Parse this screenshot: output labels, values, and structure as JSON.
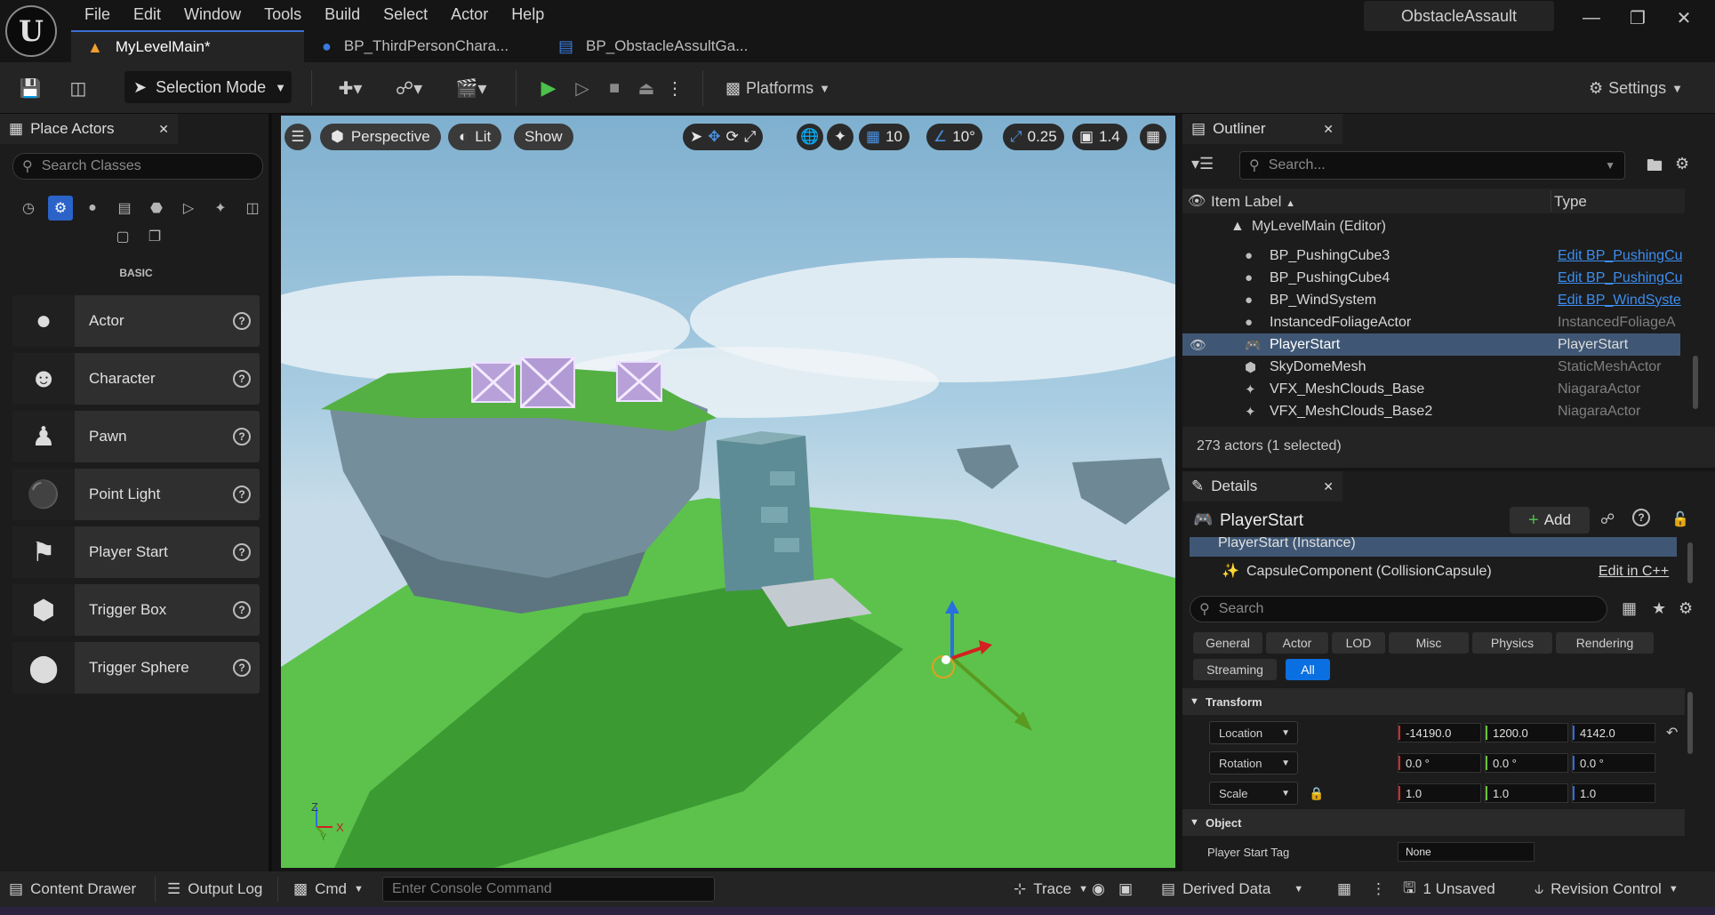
{
  "app": {
    "project": "ObstacleAssault"
  },
  "menu": [
    "File",
    "Edit",
    "Window",
    "Tools",
    "Build",
    "Select",
    "Actor",
    "Help"
  ],
  "tabs": [
    {
      "label": "MyLevelMain*"
    },
    {
      "label": "BP_ThirdPersonChara..."
    },
    {
      "label": "BP_ObstacleAssultGa..."
    }
  ],
  "toolbar": {
    "selection_mode": "Selection Mode",
    "platforms": "Platforms",
    "settings": "Settings"
  },
  "place_actors": {
    "title": "Place Actors",
    "search_placeholder": "Search Classes",
    "category": "BASIC",
    "items": [
      "Actor",
      "Character",
      "Pawn",
      "Point Light",
      "Player Start",
      "Trigger Box",
      "Trigger Sphere"
    ]
  },
  "viewport": {
    "view_mode": "Perspective",
    "lighting": "Lit",
    "show": "Show",
    "grid_snap": "10",
    "rotation_snap": "10°",
    "scale_snap": "0.25",
    "camera_speed": "1.4",
    "axis_labels": {
      "z": "Z",
      "x": "X",
      "y": "Y"
    }
  },
  "outliner": {
    "title": "Outliner",
    "search_placeholder": "Search...",
    "col_label": "Item Label",
    "col_type": "Type",
    "root": "MyLevelMain (Editor)",
    "rows": [
      {
        "name": "BP_PushingCube3",
        "type": "Edit BP_PushingCu",
        "link": true,
        "icon": "sphere-icon"
      },
      {
        "name": "BP_PushingCube4",
        "type": "Edit BP_PushingCu",
        "link": true,
        "icon": "sphere-icon"
      },
      {
        "name": "BP_WindSystem",
        "type": "Edit BP_WindSyste",
        "link": true,
        "icon": "sphere-icon"
      },
      {
        "name": "InstancedFoliageActor",
        "type": "InstancedFoliageA",
        "link": false,
        "icon": "sphere-icon"
      },
      {
        "name": "PlayerStart",
        "type": "PlayerStart",
        "link": false,
        "icon": "gamepad-icon",
        "selected": true
      },
      {
        "name": "SkyDomeMesh",
        "type": "StaticMeshActor",
        "link": false,
        "icon": "cube-icon"
      },
      {
        "name": "VFX_MeshClouds_Base",
        "type": "NiagaraActor",
        "link": false,
        "icon": "sparkle-icon"
      },
      {
        "name": "VFX_MeshClouds_Base2",
        "type": "NiagaraActor",
        "link": false,
        "icon": "sparkle-icon"
      }
    ],
    "status": "273 actors (1 selected)"
  },
  "details": {
    "title": "Details",
    "actor_name": "PlayerStart",
    "add_label": "Add",
    "instance_label": "PlayerStart (Instance)",
    "component_label": "CapsuleComponent (CollisionCapsule)",
    "edit_cpp": "Edit in C++",
    "search_placeholder": "Search",
    "filters": [
      "General",
      "Actor",
      "LOD",
      "Misc",
      "Physics",
      "Rendering",
      "Streaming",
      "All"
    ],
    "transform_header": "Transform",
    "location_label": "Location",
    "rotation_label": "Rotation",
    "scale_label": "Scale",
    "location": [
      "-14190.0",
      "1200.0",
      "4142.0"
    ],
    "rotation": [
      "0.0 °",
      "0.0 °",
      "0.0 °"
    ],
    "scale": [
      "1.0",
      "1.0",
      "1.0"
    ],
    "object_header": "Object",
    "player_start_tag_label": "Player Start Tag",
    "player_start_tag_value": "None"
  },
  "statusbar": {
    "content_drawer": "Content Drawer",
    "output_log": "Output Log",
    "cmd": "Cmd",
    "console_placeholder": "Enter Console Command",
    "trace": "Trace",
    "derived_data": "Derived Data",
    "unsaved": "1 Unsaved",
    "revision_control": "Revision Control"
  }
}
